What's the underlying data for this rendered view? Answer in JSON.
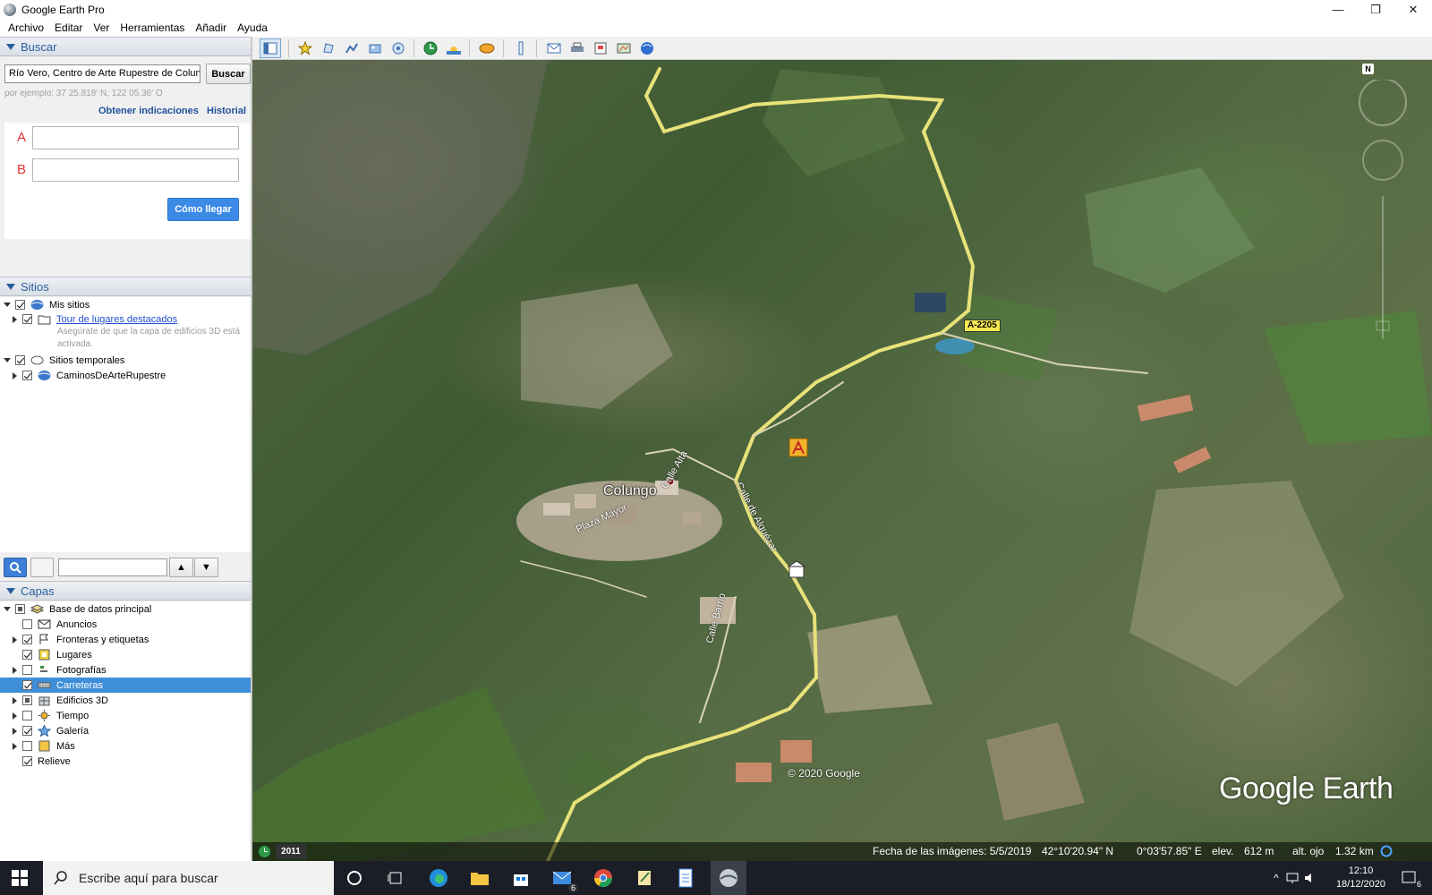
{
  "window": {
    "title": "Google Earth Pro",
    "minimize": "—",
    "restore": "❐",
    "close": "✕"
  },
  "menu": [
    "Archivo",
    "Editar",
    "Ver",
    "Herramientas",
    "Añadir",
    "Ayuda"
  ],
  "search": {
    "header": "Buscar",
    "query": "Río Vero, Centro de Arte Rupestre de Colungo)",
    "button": "Buscar",
    "hint": "por ejemplo: 37 25.818' N, 122 05.36' O",
    "directions_link": "Obtener indicaciones",
    "history_link": "Historial",
    "label_a": "A",
    "label_b": "B",
    "route_button": "Cómo llegar"
  },
  "places": {
    "header": "Sitios",
    "items": [
      {
        "label": "Mis sitios",
        "checked": true
      },
      {
        "label": "Tour de lugares destacados",
        "checked": true,
        "link": true
      },
      {
        "label": "Asegúrate de que la capa de edificios 3D está activada."
      },
      {
        "label": "Sitios temporales",
        "checked": true
      },
      {
        "label": "CaminosDeArteRupestre",
        "checked": true
      }
    ]
  },
  "layers": {
    "header": "Capas",
    "items": [
      {
        "label": "Base de datos principal",
        "state": "partial"
      },
      {
        "label": "Anuncios",
        "state": "unchecked"
      },
      {
        "label": "Fronteras y etiquetas",
        "state": "checked"
      },
      {
        "label": "Lugares",
        "state": "checked"
      },
      {
        "label": "Fotografías",
        "state": "unchecked"
      },
      {
        "label": "Carreteras",
        "state": "checked",
        "selected": true
      },
      {
        "label": "Edificios 3D",
        "state": "partial"
      },
      {
        "label": "Tiempo",
        "state": "unchecked"
      },
      {
        "label": "Galería",
        "state": "checked"
      },
      {
        "label": "Más",
        "state": "unchecked"
      },
      {
        "label": "Relieve",
        "state": "checked"
      }
    ]
  },
  "map": {
    "place_label": "Colungo",
    "street_labels": [
      "Calle Barrio",
      "Calle de Alquézar",
      "Plaza Mayor",
      "Calle Alta"
    ],
    "road_badge": "A-2205",
    "copyright": "© 2020 Google",
    "logo": "Google Earth",
    "north": "N"
  },
  "status": {
    "year": "2011",
    "imagery_date": "Fecha de las imágenes: 5/5/2019",
    "lat": "42°10'20.94\" N",
    "lon": "0°03'57.85\" E",
    "elev_label": "elev.",
    "elev": "612 m",
    "eye_label": "alt. ojo",
    "eye": "1.32 km"
  },
  "taskbar": {
    "search_placeholder": "Escribe aquí para buscar",
    "time": "12:10",
    "date": "18/12/2020",
    "mail_badge": "6",
    "notif_badge": "6"
  },
  "colors": {
    "accent": "#2b5e9f",
    "selected": "#3f8fd8",
    "route_button": "#3b8ae6",
    "road": "#e8e27a"
  }
}
